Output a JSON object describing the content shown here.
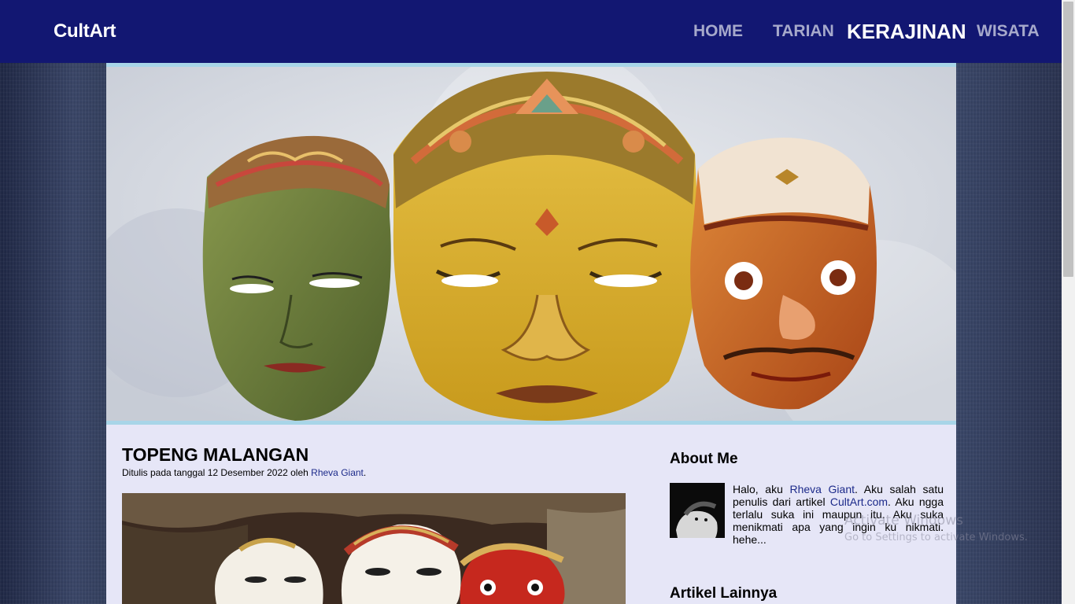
{
  "navbar": {
    "brand": "CultArt",
    "items": [
      {
        "label": "HOME",
        "active": false
      },
      {
        "label": "TARIAN",
        "active": false
      },
      {
        "label": "KERAJINAN",
        "active": true
      },
      {
        "label": "WISATA",
        "active": false
      }
    ]
  },
  "hero": {
    "image": "three-wooden-masks"
  },
  "article": {
    "title": "TOPENG MALANGAN",
    "meta_prefix": "Ditulis pada tanggal 12 Desember 2022 oleh ",
    "author": "Rheva Giant",
    "meta_suffix": ".",
    "image": "malangan-masks-photo"
  },
  "sidebar": {
    "about_title": "About Me",
    "about": {
      "text1": "Halo, aku ",
      "name": "Rheva Giant",
      "text2": ". Aku salah satu penulis dari artikel ",
      "site": "CultArt.com",
      "text3": ". Aku ngga terlalu suka ini maupun itu. Aku suka menikmati apa yang ingin ku nikmati. hehe..."
    },
    "other_title": "Artikel Lainnya"
  },
  "watermark": {
    "title": "Activate Windows",
    "subtitle": "Go to Settings to activate Windows."
  },
  "colors": {
    "navbar": "#121772",
    "active_nav": "#ffffff",
    "inactive_nav": "#a6a9cb",
    "content_bg": "#e6e6f7",
    "hero_border": "#a8d5e8",
    "link": "#1c2a8a"
  }
}
